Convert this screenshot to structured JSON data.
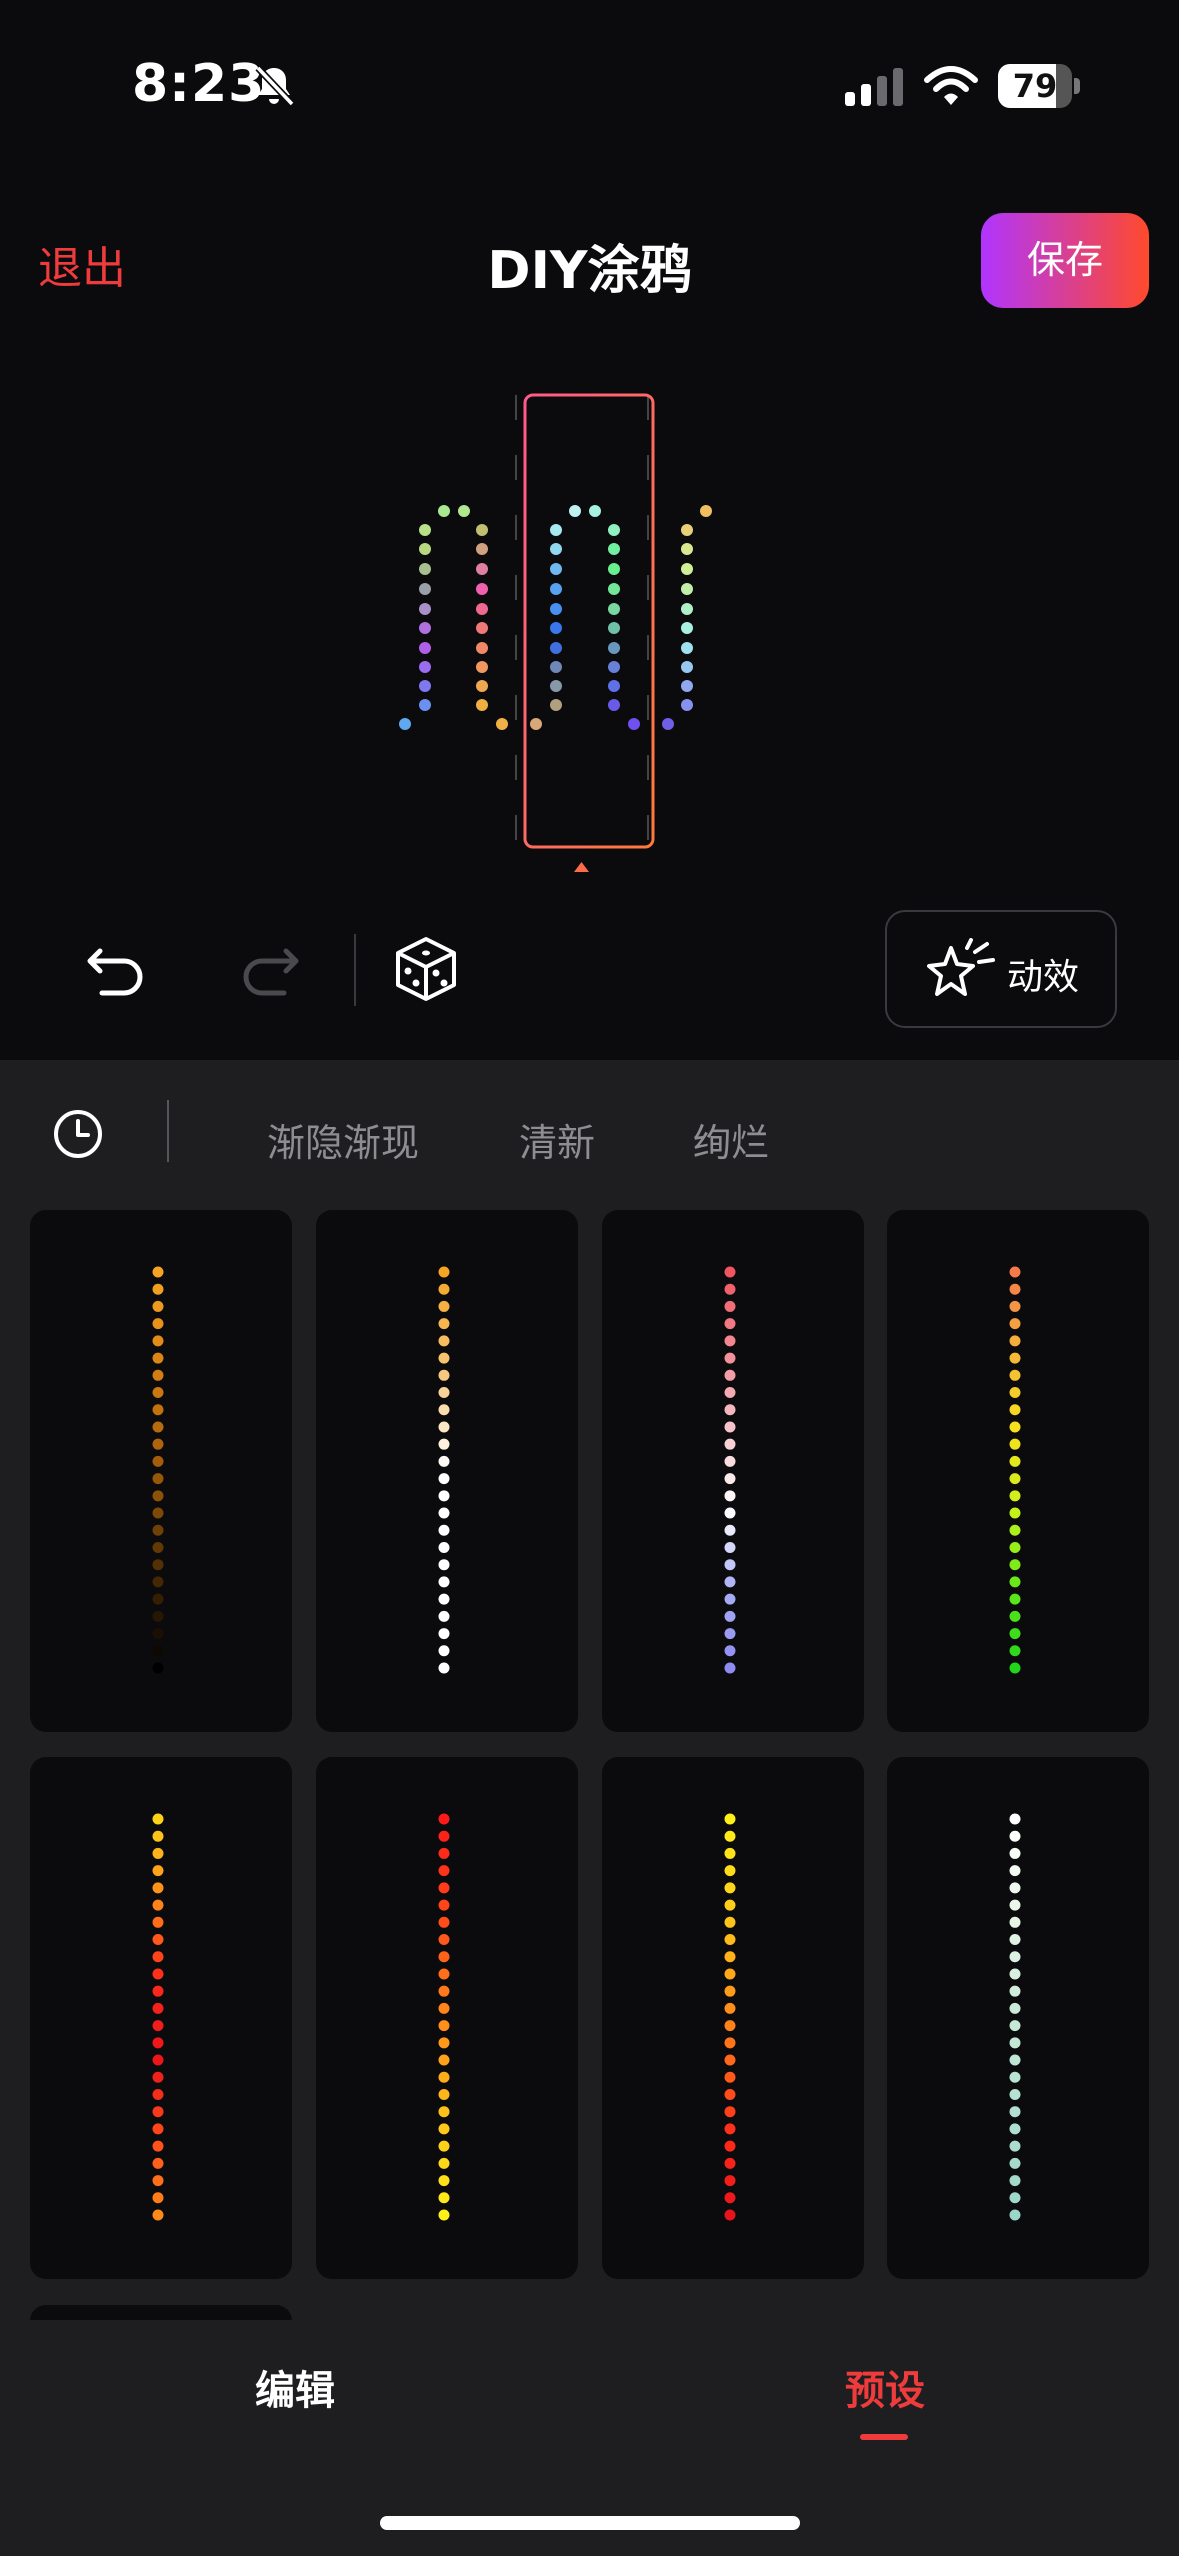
{
  "status_bar": {
    "time": "8:23",
    "battery": "79",
    "battery_level": 0.79
  },
  "header": {
    "exit_label": "退出",
    "title": "DIY涂鸦",
    "save_label": "保存"
  },
  "toolbar": {
    "effects_label": "动效"
  },
  "tabs": [
    "渐隐渐现",
    "清新",
    "绚烂"
  ],
  "bottom_nav": {
    "edit_label": "编辑",
    "preset_label": "预设",
    "active": "预设"
  },
  "preset_gradients": [
    [
      "#f5a524",
      "#e8901a",
      "#cf7a12",
      "#b0650c",
      "#8a4f08",
      "#5c3605",
      "#2a1903",
      "#000000"
    ],
    [
      "#f5a524",
      "#f7c77a",
      "#ffffff",
      "#ffffff",
      "#ffffff"
    ],
    [
      "#f05561",
      "#f28c96",
      "#f6c6cc",
      "#ffffff",
      "#a9aef5",
      "#8e8cf0"
    ],
    [
      "#f47a4c",
      "#f5b53a",
      "#f5e11d",
      "#c8f21a",
      "#60e81a",
      "#22d41a"
    ],
    [
      "#ffd21a",
      "#ff8a1a",
      "#ff2b1a",
      "#e8141a",
      "#ff4a1a",
      "#ff8a1a"
    ],
    [
      "#ff1a1a",
      "#ff4a1a",
      "#ff8a1a",
      "#ffc21a",
      "#fff01a"
    ],
    [
      "#fff01a",
      "#ffd21a",
      "#ffa51a",
      "#ff6a1a",
      "#ff2b1a",
      "#e8141a"
    ],
    [
      "#ffffff",
      "#e8f5e8",
      "#c8ead6",
      "#b0e0d0",
      "#9cd6c6"
    ]
  ]
}
